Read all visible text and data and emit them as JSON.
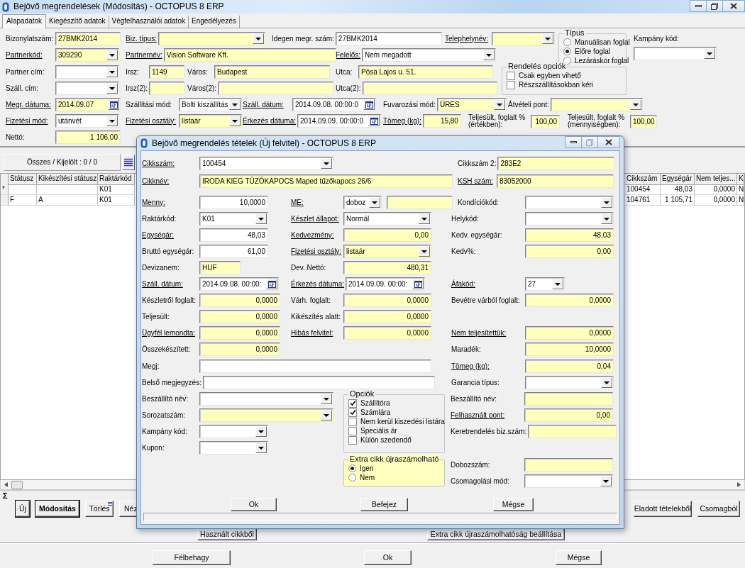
{
  "main": {
    "title": "Bejövő megrendelések (Módosítás)   -   OCTOPUS 8 ERP",
    "tabs": [
      {
        "label": "Alapadatok",
        "selected": true
      },
      {
        "label": "Kiegészítő adatok",
        "selected": false
      },
      {
        "label": "Végfelhasználói adatok",
        "selected": false
      },
      {
        "label": "Engedélyezés",
        "selected": false
      }
    ],
    "header": {
      "rows_top": [
        [
          {
            "label": "Bizonylatszám:",
            "link": false,
            "kind": "text",
            "value": "27BMK2014",
            "highlighted": true
          },
          {
            "label": "Biz. típus:",
            "link": true,
            "kind": "combo",
            "highlighted": true
          },
          {
            "label": "Idegen megr. szám:",
            "link": false,
            "kind": "text",
            "value": "27BMK2014",
            "highlighted": false
          },
          {
            "label": "Telephelynév:",
            "link": true,
            "kind": "combo",
            "highlighted": true
          }
        ],
        [
          {
            "label": "Partnerkód:",
            "link": true,
            "kind": "combo",
            "value": "309290",
            "highlighted": true
          },
          {
            "label": "Partnernév:",
            "link": true,
            "kind": "text",
            "value": "Vision Software Kft.",
            "highlighted": true
          },
          {
            "label": "Felelős:",
            "link": true,
            "kind": "combo",
            "value": "Nem megadott",
            "highlighted": false
          }
        ]
      ],
      "type_group": {
        "title": "Típus",
        "options": [
          {
            "label": "Manuálisan foglal",
            "selected": false
          },
          {
            "label": "Előre foglal",
            "selected": true
          },
          {
            "label": "Lezáráskor foglal",
            "selected": false
          }
        ]
      },
      "campaign": {
        "label": "Kampány kód:",
        "link": false,
        "kind": "combo",
        "highlighted": false
      },
      "rows_mid": [
        [
          {
            "label": "Partner cím:",
            "link": false,
            "kind": "combo",
            "highlighted": false
          },
          {
            "label": "Irsz:",
            "link": false,
            "kind": "text",
            "value": "1149",
            "highlighted": true
          },
          {
            "label": "Város:",
            "link": false,
            "kind": "text",
            "value": "Budapest",
            "highlighted": true
          },
          {
            "label": "Utca:",
            "link": false,
            "kind": "text",
            "value": "Pósa Lajos u. 51.",
            "highlighted": true
          }
        ],
        [
          {
            "label": "Száll. cím:",
            "link": false,
            "kind": "combo",
            "highlighted": false
          },
          {
            "label": "Irsz(2):",
            "link": false,
            "kind": "text",
            "highlighted": true
          },
          {
            "label": "Város(2):",
            "link": false,
            "kind": "text",
            "highlighted": true
          },
          {
            "label": "Utca(2):",
            "link": false,
            "kind": "text",
            "highlighted": true
          }
        ]
      ],
      "order_options": {
        "title": "Rendelés opciók",
        "options": [
          {
            "label": "Csak egyben vihető",
            "checked": false
          },
          {
            "label": "Részszállításokban kéri",
            "checked": false
          }
        ]
      },
      "rows_bottom": [
        [
          {
            "label": "Megr. dátuma:",
            "link": true,
            "kind": "date",
            "value": "2014.09.07",
            "highlighted": true
          },
          {
            "label": "Szállítási mód:",
            "link": false,
            "kind": "combo",
            "value": "Bolti kiszállítás",
            "highlighted": false
          },
          {
            "label": "Száll. dátum:",
            "link": true,
            "kind": "date",
            "value": "2014.09.08. 00:00:0",
            "highlighted": false
          },
          {
            "label": "Fuvarozási mód:",
            "link": false,
            "kind": "combo",
            "value": "ÜRES",
            "highlighted": true
          },
          {
            "label": "Átvételi pont:",
            "link": false,
            "kind": "combo",
            "highlighted": true
          }
        ],
        [
          {
            "label": "Fizetési mód:",
            "link": true,
            "kind": "combo",
            "value": "utánvét",
            "highlighted": false
          },
          {
            "label": "Fizetési osztály:",
            "link": true,
            "kind": "combo",
            "value": "listaár",
            "highlighted": true
          },
          {
            "label": "Érkezés dátuma:",
            "link": true,
            "kind": "date",
            "value": "2014.09.09. 00:00:0",
            "highlighted": false
          },
          {
            "label": "Tömeg (kg):",
            "link": true,
            "kind": "number",
            "value": "15,80",
            "highlighted": true
          },
          {
            "label": "Teljesült, foglalt % (értékben):",
            "link": false,
            "kind": "number",
            "value": "100,00",
            "highlighted": true
          },
          {
            "label": "Teljesült, foglalt % (mennyiségben):",
            "link": false,
            "kind": "number",
            "value": "100,00",
            "highlighted": true
          }
        ],
        [
          {
            "label": "Nettó:",
            "link": false,
            "kind": "number",
            "value": "1 106,00",
            "highlighted": true
          }
        ]
      ]
    },
    "grid": {
      "summary": "Összes / Kijelölt :   0 / 0",
      "left_columns": [
        {
          "numeric": false
        },
        {
          "label": "Státusz",
          "numeric": false
        },
        {
          "label": "Kikészítési státusz",
          "numeric": false
        },
        {
          "label": "Raktárkód",
          "numeric": false
        }
      ],
      "left_rows": [
        [
          "*",
          "",
          "",
          "K01"
        ],
        [
          "",
          "F",
          "A",
          "K01"
        ]
      ],
      "right_columns": [
        {
          "label": "Cikkszám",
          "numeric": false
        },
        {
          "label": "Egységár",
          "numeric": true
        },
        {
          "label": "Nem teljes...",
          "numeric": true
        },
        {
          "label": "K"
        }
      ],
      "right_rows": [
        [
          "100454",
          "48,03",
          "0,0000",
          "N"
        ],
        [
          "104761",
          "1 105,71",
          "0,0000",
          "N"
        ]
      ]
    },
    "sum_label": "Σ",
    "actions_left": [
      {
        "label": "Új",
        "kind": "focus"
      },
      {
        "label": "Módosítás",
        "kind": "bold"
      },
      {
        "label": "Törlés",
        "kind": "menu"
      },
      {
        "label": "Néz",
        "kind": "clipped"
      }
    ],
    "actions_right": [
      "Eladott tételekből",
      "Csomagból"
    ],
    "actions_second": [
      "Használt cikkből",
      "Extra cikk újraszámolhatóság beállítása"
    ],
    "footer_buttons": [
      "Félbehagy",
      "Ok",
      "Mégse"
    ]
  },
  "dialog": {
    "title": "Bejövő megrendelés tételek (Új felvitel)   -   OCTOPUS 8 ERP",
    "rows": [
      [
        {
          "label": "Cikkszám:",
          "link": true,
          "kind": "combo",
          "value": "100454",
          "highlighted": false
        },
        {
          "label": "Cikkszám 2:",
          "link": false,
          "kind": "text",
          "value": "283E2",
          "highlighted": true
        }
      ],
      [
        {
          "label": "Cikknév:",
          "link": true,
          "kind": "text",
          "value": "IRODA KIEG TŰZŐKAPOCS Maped tűzőkapocs 26/6",
          "highlighted": true
        },
        {
          "label": "KSH szám:",
          "link": true,
          "kind": "text",
          "value": "83052000",
          "highlighted": true
        }
      ],
      [
        {
          "label": "Menny:",
          "link": true,
          "kind": "number",
          "value": "10,0000",
          "highlighted": false
        },
        {
          "label": "ME:",
          "link": true,
          "kind": "combo",
          "value": "doboz",
          "highlighted": false
        },
        {
          "kind": "text",
          "highlighted": true
        },
        {
          "label": "Kondíciókód:",
          "link": false,
          "kind": "combo",
          "highlighted": false
        }
      ],
      [
        {
          "label": "Raktárkód:",
          "link": false,
          "kind": "combo",
          "value": "K01",
          "highlighted": false
        },
        {
          "label": "Készlet állapot:",
          "link": true,
          "kind": "combo",
          "value": "Normál",
          "highlighted": false
        },
        {
          "label": "Helykód:",
          "link": false,
          "kind": "combo",
          "highlighted": false
        }
      ],
      [
        {
          "label": "Egységár:",
          "link": true,
          "kind": "number",
          "value": "48,03",
          "highlighted": false
        },
        {
          "label": "Kedvezmény:",
          "link": true,
          "kind": "number",
          "value": "0,00",
          "highlighted": true
        },
        {
          "label": "Kedv. egységár:",
          "link": false,
          "kind": "number",
          "value": "48,03",
          "highlighted": true
        }
      ],
      [
        {
          "label": "Bruttó egységár:",
          "link": false,
          "kind": "number",
          "value": "61,00",
          "highlighted": false
        },
        {
          "label": "Fizetési osztály:",
          "link": true,
          "kind": "combo",
          "value": "listaár",
          "highlighted": true
        },
        {
          "label": "Kedv%:",
          "link": false,
          "kind": "number",
          "value": "0,00",
          "highlighted": true
        }
      ],
      [
        {
          "label": "Devizanem:",
          "link": false,
          "kind": "text",
          "value": "HUF",
          "highlighted": true
        },
        {
          "label": "Dev. Nettó:",
          "link": false,
          "kind": "number",
          "value": "480,31",
          "highlighted": true
        }
      ],
      [
        {
          "label": "Száll. dátum:",
          "link": true,
          "kind": "date",
          "value": "2014.09.08. 00:00:",
          "highlighted": false
        },
        {
          "label": "Érkezés dátuma:",
          "link": true,
          "kind": "date",
          "value": "2014.09.09. 00:00:",
          "highlighted": false
        },
        {
          "label": "Áfakód:",
          "link": true,
          "kind": "combo",
          "value": "27",
          "highlighted": false
        }
      ],
      [
        {
          "label": "Készletről foglalt:",
          "link": false,
          "kind": "number",
          "value": "0,0000",
          "highlighted": true
        },
        {
          "label": "Várh. foglalt:",
          "link": false,
          "kind": "number",
          "value": "0,0000",
          "highlighted": true
        },
        {
          "label": "Bevétre várból foglalt:",
          "link": false,
          "kind": "number",
          "value": "0,0000",
          "highlighted": true
        }
      ],
      [
        {
          "label": "Teljesült:",
          "link": false,
          "kind": "number",
          "value": "0,0000",
          "highlighted": true
        },
        {
          "label": "Kikészítés alatt:",
          "link": false,
          "kind": "number",
          "value": "0,0000",
          "highlighted": true
        }
      ],
      [
        {
          "label": "Ügyfél lemondta:",
          "link": true,
          "kind": "number",
          "value": "0,0000",
          "highlighted": true
        },
        {
          "label": "Hibás felvitel:",
          "link": true,
          "kind": "number",
          "value": "0,0000",
          "highlighted": true
        },
        {
          "label": "Nem teljesítettük:",
          "link": true,
          "kind": "number",
          "value": "0,0000",
          "highlighted": true
        }
      ],
      [
        {
          "label": "Összekészített:",
          "link": false,
          "kind": "number",
          "value": "0,0000",
          "highlighted": true
        },
        {
          "label": "Maradék:",
          "link": false,
          "kind": "number",
          "value": "10,0000",
          "highlighted": true
        }
      ],
      [
        {
          "label": "Megj:",
          "link": false,
          "kind": "text",
          "highlighted": false
        },
        {
          "label": "Tömeg (kg):",
          "link": true,
          "kind": "number",
          "value": "0,04",
          "highlighted": true
        }
      ],
      [
        {
          "label": "Belső megjegyzés:",
          "link": false,
          "kind": "text",
          "highlighted": false
        },
        {
          "label": "Garancia típus:",
          "link": false,
          "kind": "combo",
          "highlighted": false
        }
      ]
    ],
    "lower_left": [
      {
        "label": "Beszállító név:",
        "link": false,
        "kind": "combo",
        "highlighted": false
      },
      {
        "label": "Sorozatszám:",
        "link": false,
        "kind": "combo",
        "highlighted": true
      },
      {
        "label": "Kampány kód:",
        "link": false,
        "kind": "combo",
        "highlighted": false
      },
      {
        "label": "Kupon:",
        "link": false,
        "kind": "combo",
        "highlighted": false
      }
    ],
    "options": {
      "title": "Opciók",
      "options": [
        {
          "label": "Szállítóra",
          "checked": true
        },
        {
          "label": "Számlára",
          "checked": true
        },
        {
          "label": "Nem kerül kiszedési listára",
          "checked": false
        },
        {
          "label": "Speciális ár",
          "checked": false
        },
        {
          "label": "Külön szedendő",
          "checked": false
        }
      ]
    },
    "extra": {
      "title": "Extra cikk újraszámolható",
      "options": [
        {
          "label": "Igen",
          "selected": true
        },
        {
          "label": "Nem",
          "selected": false
        }
      ]
    },
    "lower_right": [
      {
        "label": "Beszállító név:",
        "link": false,
        "kind": "text",
        "highlighted": true
      },
      {
        "label": "Felhasznált pont:",
        "link": true,
        "kind": "number",
        "value": "0,00",
        "highlighted": true
      },
      {
        "label": "Keretrendelés biz.szám:",
        "link": false,
        "kind": "text",
        "highlighted": true
      },
      {
        "label": "Dobozszám:",
        "link": false,
        "kind": "text",
        "highlighted": true
      },
      {
        "label": "Csomagolási mód:",
        "link": false,
        "kind": "combo",
        "highlighted": false
      }
    ],
    "buttons": [
      "Ok",
      "Befejez",
      "Mégse"
    ]
  }
}
